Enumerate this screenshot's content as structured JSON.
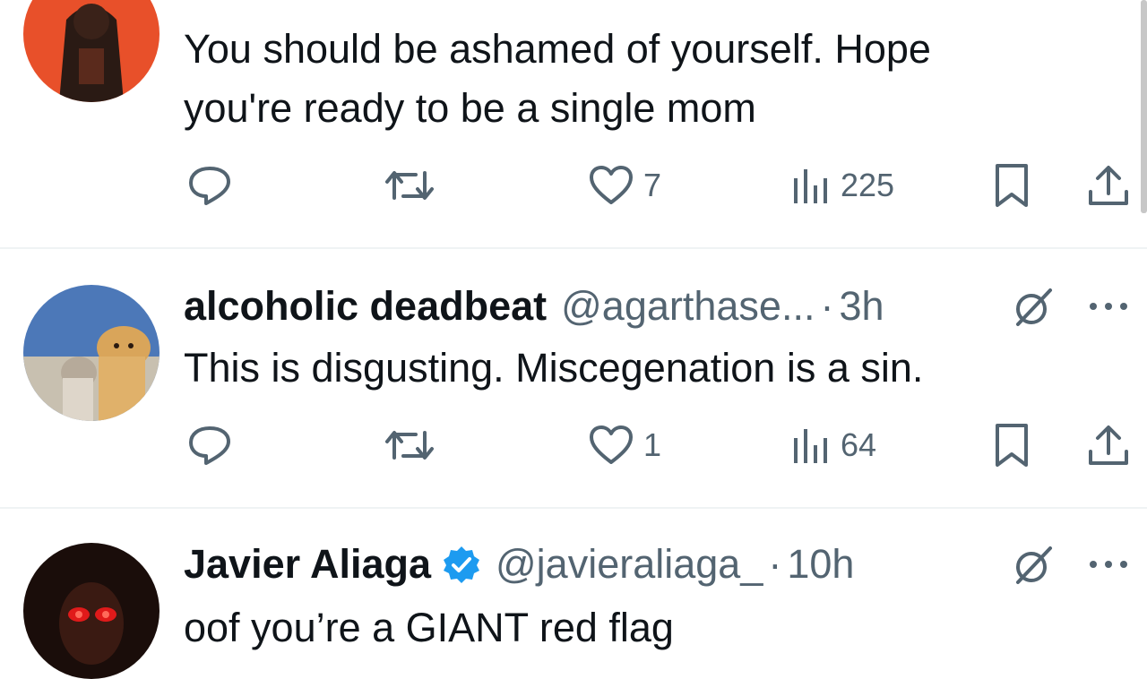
{
  "tweets": [
    {
      "name": "",
      "handle": "",
      "time": "",
      "body": [
        "You should be ashamed of yourself. Hope",
        "you're ready to be a single mom"
      ],
      "replies": "",
      "reposts": "",
      "likes": "7",
      "views": "225"
    },
    {
      "name": "alcoholic deadbeat",
      "handle": "@agarthase...",
      "dot": "·",
      "time": "3h",
      "body": [
        "This is disgusting. Miscegenation is a sin."
      ],
      "likes": "1",
      "views": "64"
    },
    {
      "name": "Javier Aliaga",
      "verified": true,
      "handle": "@javieraliaga_",
      "dot": "·",
      "time": "10h",
      "body": [
        "oof you’re a GIANT red flag"
      ]
    }
  ],
  "icons": {
    "reply": "speech-bubble-icon",
    "repost": "repost-arrows-icon",
    "like": "heart-icon",
    "views": "bar-chart-icon",
    "bookmark": "bookmark-icon",
    "share": "share-upload-icon",
    "grok": "grok-slash-icon",
    "more": "ellipsis-icon",
    "verified": "verified-badge-icon"
  },
  "colors": {
    "text": "#0f1419",
    "secondary": "#536471",
    "verified": "#1d9bf0",
    "divider": "#eff3f4"
  }
}
